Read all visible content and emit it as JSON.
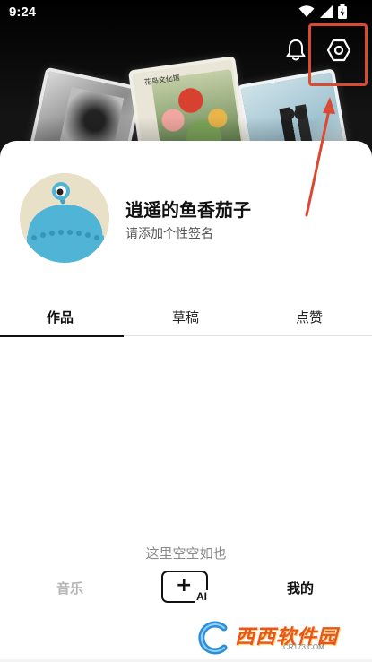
{
  "status_bar": {
    "time": "9:24"
  },
  "header": {
    "album_label": "花鸟文化馆",
    "bell_icon": "bell-icon",
    "settings_icon": "settings-hexagon-icon",
    "highlight_color": "#d94a32"
  },
  "profile": {
    "username": "逍遥的鱼香茄子",
    "signature": "请添加个性签名",
    "avatar_icon": "blue-octopus-avatar"
  },
  "tabs": [
    {
      "label": "作品",
      "active": true
    },
    {
      "label": "草稿",
      "active": false
    },
    {
      "label": "点赞",
      "active": false
    }
  ],
  "empty_state": {
    "text": "这里空空如也"
  },
  "bottom_nav": {
    "music_label": "音乐",
    "create_plus": "+",
    "create_ai": "AI",
    "mine_label": "我的"
  },
  "watermark": {
    "text": "西西软件园",
    "url": "CR173.COM"
  },
  "colors": {
    "accent_red": "#d94a32",
    "header_bg": "#000000",
    "watermark_orange": "#e8551f"
  }
}
